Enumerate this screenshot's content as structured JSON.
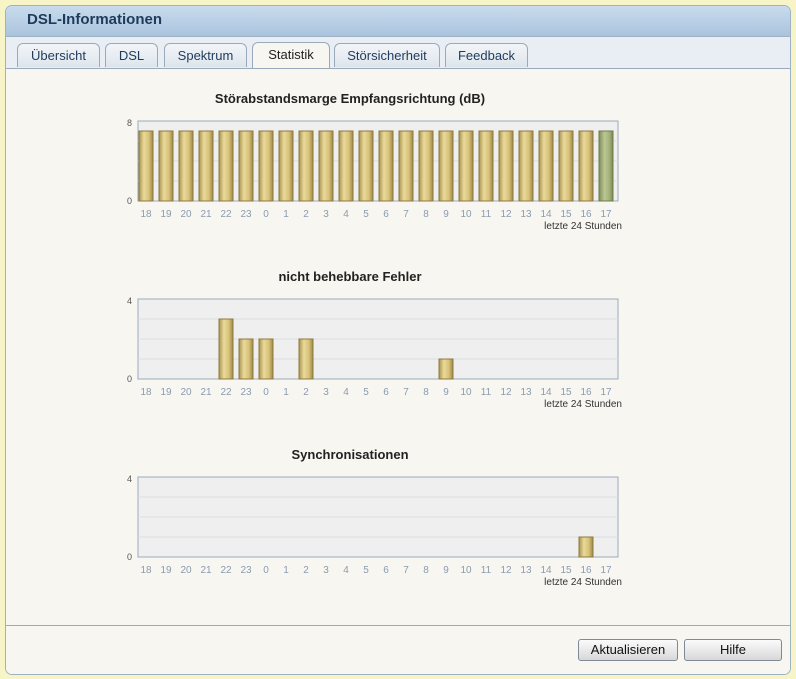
{
  "window": {
    "title": "DSL-Informationen"
  },
  "tabs": [
    {
      "label": "Übersicht",
      "active": false
    },
    {
      "label": "DSL",
      "active": false
    },
    {
      "label": "Spektrum",
      "active": false
    },
    {
      "label": "Statistik",
      "active": true
    },
    {
      "label": "Störsicherheit",
      "active": false
    },
    {
      "label": "Feedback",
      "active": false
    }
  ],
  "buttons": {
    "refresh_label": "Aktualisieren",
    "help_label": "Hilfe"
  },
  "colors": {
    "bar_gold": "#d8c27a",
    "bar_green": "#a3b07a",
    "grid_bg": "#efefef",
    "axis": "#9aaabb"
  },
  "chart_data": [
    {
      "type": "bar",
      "title": "Störabstandsmarge Empfangsrichtung (dB)",
      "categories": [
        "18",
        "19",
        "20",
        "21",
        "22",
        "23",
        "0",
        "1",
        "2",
        "3",
        "4",
        "5",
        "6",
        "7",
        "8",
        "9",
        "10",
        "11",
        "12",
        "13",
        "14",
        "15",
        "16",
        "17"
      ],
      "values": [
        7,
        7,
        7,
        7,
        7,
        7,
        7,
        7,
        7,
        7,
        7,
        7,
        7,
        7,
        7,
        7,
        7,
        7,
        7,
        7,
        7,
        7,
        7,
        7
      ],
      "ylim": [
        0,
        8
      ],
      "yticks": [
        "0",
        "8"
      ],
      "xnote": "letzte 24 Stunden",
      "highlight_last": true
    },
    {
      "type": "bar",
      "title": "nicht behebbare Fehler",
      "categories": [
        "18",
        "19",
        "20",
        "21",
        "22",
        "23",
        "0",
        "1",
        "2",
        "3",
        "4",
        "5",
        "6",
        "7",
        "8",
        "9",
        "10",
        "11",
        "12",
        "13",
        "14",
        "15",
        "16",
        "17"
      ],
      "values": [
        0,
        0,
        0,
        0,
        3,
        2,
        2,
        0,
        2,
        0,
        0,
        0,
        0,
        0,
        0,
        1,
        0,
        0,
        0,
        0,
        0,
        0,
        0,
        0
      ],
      "ylim": [
        0,
        4
      ],
      "yticks": [
        "0",
        "4"
      ],
      "xnote": "letzte 24 Stunden",
      "highlight_last": false
    },
    {
      "type": "bar",
      "title": "Synchronisationen",
      "categories": [
        "18",
        "19",
        "20",
        "21",
        "22",
        "23",
        "0",
        "1",
        "2",
        "3",
        "4",
        "5",
        "6",
        "7",
        "8",
        "9",
        "10",
        "11",
        "12",
        "13",
        "14",
        "15",
        "16",
        "17"
      ],
      "values": [
        0,
        0,
        0,
        0,
        0,
        0,
        0,
        0,
        0,
        0,
        0,
        0,
        0,
        0,
        0,
        0,
        0,
        0,
        0,
        0,
        0,
        0,
        1,
        0
      ],
      "ylim": [
        0,
        4
      ],
      "yticks": [
        "0",
        "4"
      ],
      "xnote": "letzte 24 Stunden",
      "highlight_last": false
    }
  ]
}
